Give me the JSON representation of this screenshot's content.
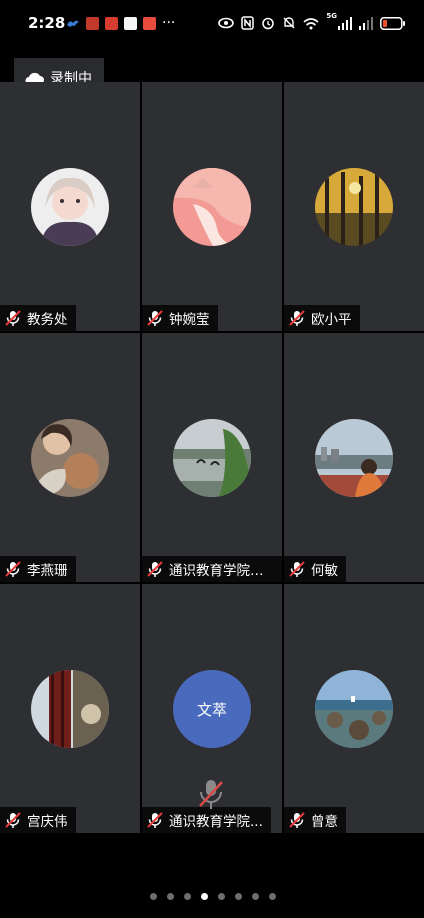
{
  "status_bar": {
    "time": "2:28",
    "overflow": "···",
    "signal_5g": "5G",
    "battery_color": "#f0512c"
  },
  "recording": {
    "label": "录制中",
    "icon": "cloud-icon"
  },
  "participants": [
    {
      "name": "教务处",
      "avatar": "photo",
      "mic": "muted"
    },
    {
      "name": "钟婉莹",
      "avatar": "photo",
      "mic": "muted"
    },
    {
      "name": "欧小平",
      "avatar": "photo",
      "mic": "muted"
    },
    {
      "name": "李燕珊",
      "avatar": "photo",
      "mic": "muted"
    },
    {
      "name": "通识教育学院向...",
      "avatar": "photo",
      "mic": "muted"
    },
    {
      "name": "何敏",
      "avatar": "photo",
      "mic": "muted"
    },
    {
      "name": "宫庆伟",
      "avatar": "photo",
      "mic": "muted"
    },
    {
      "name": "通识教育学院...",
      "avatar": "文萃",
      "avatar_color": "#4a6bbd",
      "mic": "muted"
    },
    {
      "name": "曾意",
      "avatar": "photo",
      "mic": "muted"
    }
  ],
  "pager": {
    "pages": 8,
    "active": 4
  }
}
